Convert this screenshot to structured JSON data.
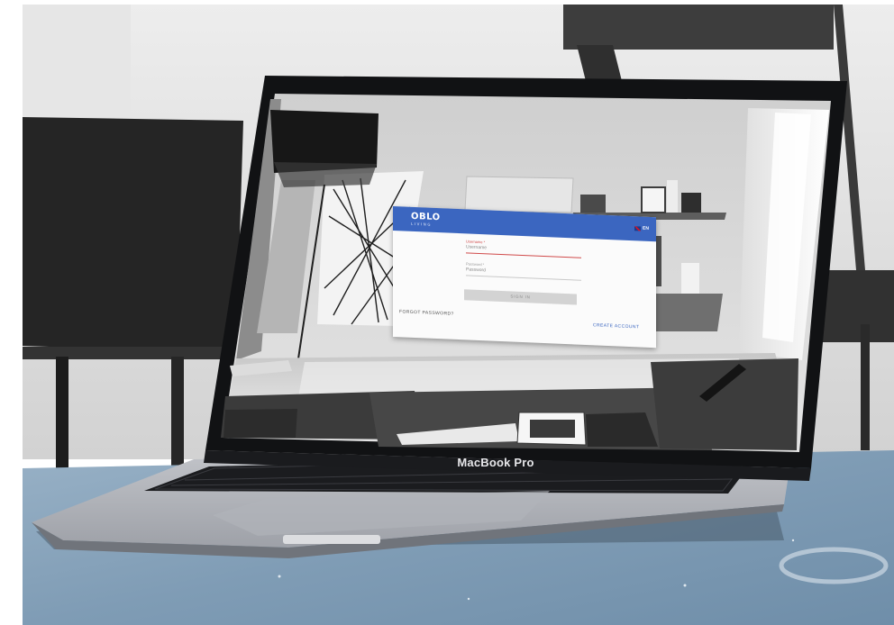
{
  "device": {
    "label": "MacBook Pro"
  },
  "login": {
    "logo": "OBLO",
    "logo_sub": "LIVING",
    "language": "EN",
    "username": {
      "label": "Username *",
      "value": "Username"
    },
    "password": {
      "label": "Password *",
      "value": "Password"
    },
    "sign_in_label": "SIGN IN",
    "forgot_password_label": "FORGOT PASSWORD?",
    "create_account_label": "CREATE ACCOUNT"
  },
  "colors": {
    "header_blue": "#3b66c0",
    "accent_red": "#d04a4a",
    "table_top": "#8aa7c0"
  }
}
